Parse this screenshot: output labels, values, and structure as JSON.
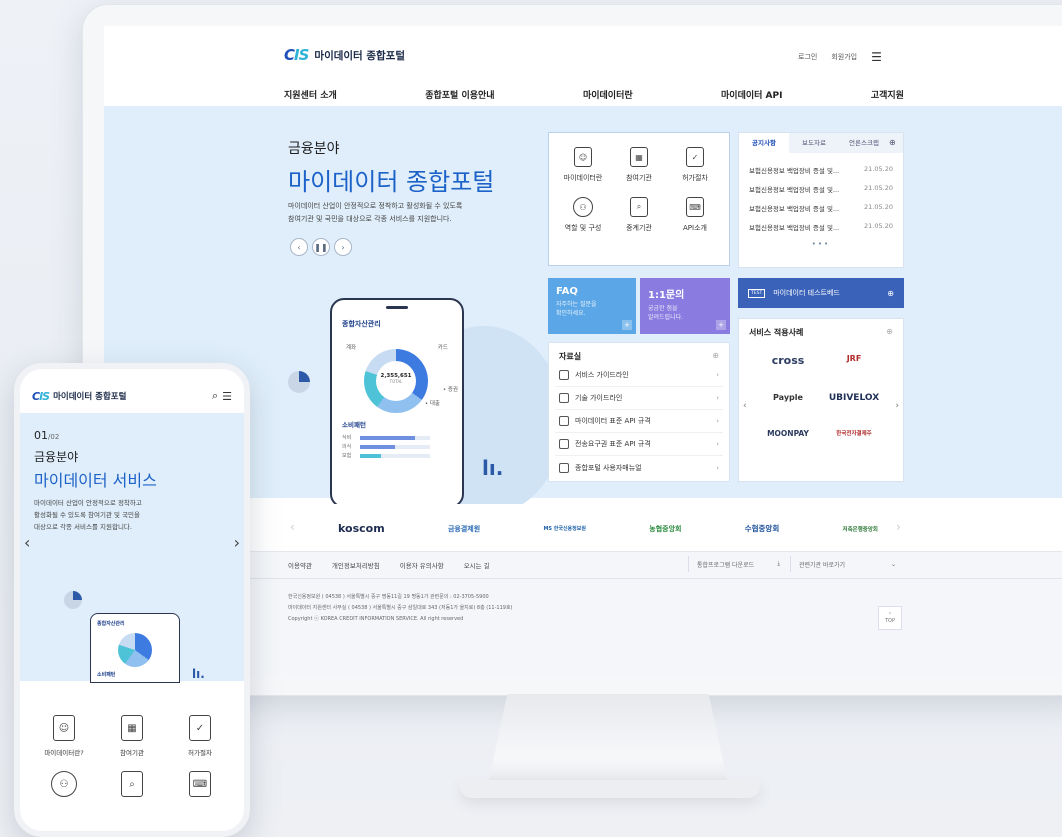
{
  "site": {
    "logo_text": "마이데이터 종합포털",
    "logo_mark_a": "C",
    "logo_mark_b": "IS",
    "login": "로그인",
    "signup": "회원가입"
  },
  "nav": [
    "지원센터 소개",
    "종합포털 이용안내",
    "마이데이터란",
    "마이데이터 API",
    "고객지원"
  ],
  "hero": {
    "kicker": "금융분야",
    "title": "마이데이터 종합포털",
    "desc_line1": "마이데이터 산업이 안정적으로 정착하고 활성화될 수 있도록",
    "desc_line2": "참여기관 및 국민을 대상으로 각종 서비스를 지원합니다."
  },
  "app_preview": {
    "title": "종합자산관리",
    "left_label": "계좌",
    "right_label": "카드",
    "total_value": "2,355,651",
    "total_label": "TOTAL",
    "legend_a": "증권",
    "legend_b": "대출",
    "pattern_title": "소비패턴",
    "bars": [
      {
        "label": "식비",
        "value": 0.78
      },
      {
        "label": "의식",
        "value": 0.5
      },
      {
        "label": "보험",
        "value": 0.3
      }
    ]
  },
  "quick_menu": [
    {
      "label": "마이데이터란",
      "icon": "person-card-icon"
    },
    {
      "label": "참여기관",
      "icon": "building-icon"
    },
    {
      "label": "허가절차",
      "icon": "clipboard-icon"
    },
    {
      "label": "역할 및 구성",
      "icon": "network-icon"
    },
    {
      "label": "중계기관",
      "icon": "document-search-icon"
    },
    {
      "label": "API소개",
      "icon": "api-monitor-icon"
    }
  ],
  "news": {
    "tabs": [
      "공지사항",
      "보도자료",
      "언론스크랩"
    ],
    "items": [
      {
        "title": "보험신용정보 백업장비 증설 및...",
        "date": "21.05.20"
      },
      {
        "title": "보험신용정보 백업장비 증설 및...",
        "date": "21.05.20"
      },
      {
        "title": "보험신용정보 백업장비 증설 및...",
        "date": "21.05.20"
      },
      {
        "title": "보험신용정보 백업장비 증설 및...",
        "date": "21.05.20"
      }
    ]
  },
  "faq": {
    "title": "FAQ",
    "line1": "자주하는 질문을",
    "line2": "확인하세요."
  },
  "inquiry": {
    "title": "1:1문의",
    "line1": "궁금한 점을",
    "line2": "알려드립니다."
  },
  "testbed": {
    "badge": "TEST",
    "label": "마이데이터 테스트베드"
  },
  "resources": {
    "title": "자료실",
    "items": [
      "서비스 가이드라인",
      "기술 가이드라인",
      "마이데이터 표준 API 규격",
      "전송요구권 표준 API 규격",
      "종합포털 사용자매뉴얼"
    ]
  },
  "cases": {
    "title": "서비스 적용사례",
    "logos": [
      "cross",
      "JRF",
      "Payple",
      "UBIVELOX",
      "MOONPAY",
      "한국전자결제주"
    ]
  },
  "partners": [
    "koscom",
    "금융결제원",
    "MS 한국신용정보원",
    "농협중앙회",
    "수협중앙회",
    "저축은행중앙회"
  ],
  "footer": {
    "links": [
      "이용약관",
      "개인정보처리방침",
      "이용자 유의사항",
      "오시는 길"
    ],
    "download": "통합프로그램 다운로드",
    "related": "관련기관 바로가기",
    "addr1": "한국신용정보원 ( 04538 ) 서울특별시 중구 명동11길 19 명동1가  관련문의 : 02-3705-5900",
    "addr2": "마이데이터 지원센터 사무실 ( 04538 ) 서울특별시 중구 삼일대로 343 (저동1가 을지로) 8층 (11-119호)",
    "copyright": "Copyright ⓒ KOREA CREDIT INFORMATION SERVICE. All right reserved",
    "top": "TOP"
  },
  "mobile": {
    "logo_text": "마이데이터 종합포털",
    "slide_current": "01",
    "slide_total": "02",
    "kicker": "금융분야",
    "title": "마이데이터 서비스",
    "desc_line1": "마이데이터 산업이 안정적으로 정착하고",
    "desc_line2": "활성화될 수 있도록 참여기관 및 국민을",
    "desc_line3": "대상으로 각종 서비스를 지원합니다.",
    "card_title": "종합자산관리",
    "pattern_title": "소비패턴",
    "menu": [
      {
        "label": "마이데이터란?",
        "icon": "person-card-icon"
      },
      {
        "label": "참여기관",
        "icon": "building-icon"
      },
      {
        "label": "허가절차",
        "icon": "clipboard-icon"
      }
    ]
  },
  "colors": {
    "brand": "#1f4fb8",
    "accent": "#2fb3d6",
    "faq": "#5aa6e6",
    "inquiry": "#8a7be0",
    "testbed": "#3a62b8",
    "hero_bg": "#dfeefa"
  }
}
